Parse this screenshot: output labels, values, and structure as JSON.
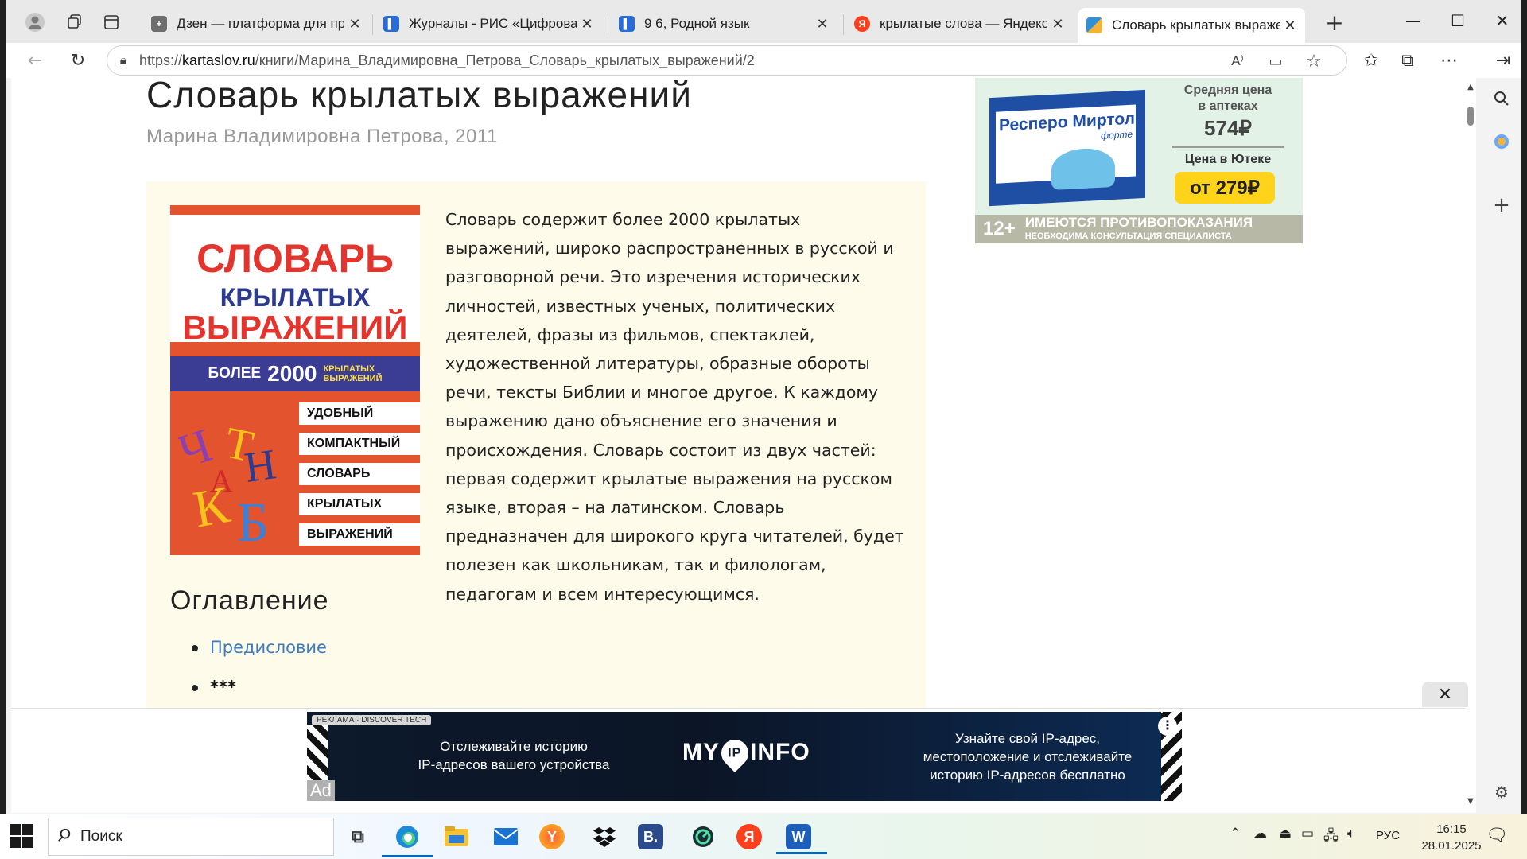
{
  "tabs": [
    {
      "title": "Дзен — платформа для просмо",
      "favicon": "plus-square-icon",
      "color": "#555555"
    },
    {
      "title": "Журналы - РИС «Цифровая обр",
      "favicon": "document-icon",
      "color": "#2b6cd3"
    },
    {
      "title": "9 6, Родной язык",
      "favicon": "document-icon",
      "color": "#2b6cd3"
    },
    {
      "title": "крылатые слова — Яндекс: наш",
      "favicon": "yandex-icon",
      "color": "#fc3f1d"
    },
    {
      "title": "Словарь крылатых выражений",
      "favicon": "book-icon",
      "color": "#2f8fd8"
    }
  ],
  "address": {
    "scheme": "https://",
    "host": "kartaslov.ru",
    "path": "/книги/Марина_Владимировна_Петрова_Словарь_крылатых_выражений/2"
  },
  "book": {
    "title": "Словарь крылатых выражений",
    "author_year": "Марина Владимировна Петрова, 2011",
    "description": "Словарь содержит более 2000 крылатых выражений, широко распространенных в русской и разговорной речи. Это изречения исторических личностей, известных ученых, политических деятелей, фразы из фильмов, спектаклей, художественной литературы, образные обороты речи, тексты Библии и многое другое. К каждому выражению дано объяснение его значения и происхождения. Словарь состоит из двух частей: первая содержит крылатые выражения на русском языке, вторая – на латинском. Словарь предназначен для широкого круга читателей, будет полезен как школьникам, так и филологам, педагогам и всем интересующимся."
  },
  "cover": {
    "line1": "СЛОВАРЬ",
    "line2": "КРЫЛАТЫХ",
    "line3": "ВЫРАЖЕНИЙ",
    "band_prefix": "БОЛЕЕ",
    "band_number": "2000",
    "band_suffix_1": "КРЫЛАТЫХ",
    "band_suffix_2": "ВЫРАЖЕНИЙ",
    "stripes": [
      "УДОБНЫЙ",
      "КОМПАКТНЫЙ",
      "СЛОВАРЬ",
      "КРЫЛАТЫХ",
      "ВЫРАЖЕНИЙ"
    ]
  },
  "toc": {
    "title": "Оглавление",
    "items": [
      {
        "label": "Предисловие",
        "link": true
      },
      {
        "label": "***",
        "link": false
      }
    ]
  },
  "ad_right": {
    "brand": "Респеро Миртол",
    "brand_sub": "форте",
    "price_label_1": "Средняя цена",
    "price_label_2": "в аптеках",
    "price": "574₽",
    "utk_label": "Цена в Ютеке",
    "utk_price": "от 279₽",
    "age": "12+",
    "warning_1": "ИМЕЮТСЯ ПРОТИВОПОКАЗАНИЯ",
    "warning_2": "НЕОБХОДИМА КОНСУЛЬТАЦИЯ СПЕЦИАЛИСТА"
  },
  "ad_bottom": {
    "tag": "РЕКЛАМА · DISCOVER TECH",
    "left_1": "Отслеживайте историю",
    "left_2": "IP-адресов вашего устройства",
    "logo_pre": "MY",
    "logo_mid": "IP",
    "logo_post": "INFO",
    "right_1": "Узнайте свой IP-адрес,",
    "right_2": "местоположение и отслеживайте",
    "right_3": "историю IP-адресов бесплатно",
    "ad_label": "Ad"
  },
  "taskbar": {
    "search_placeholder": "Поиск",
    "lang": "РУС",
    "time": "16:15",
    "date": "28.01.2025"
  },
  "colors": {
    "link": "#3b7bbf",
    "card_bg": "#fffbea",
    "cover_red": "#e3532d",
    "cover_blue": "#3b3c93"
  }
}
